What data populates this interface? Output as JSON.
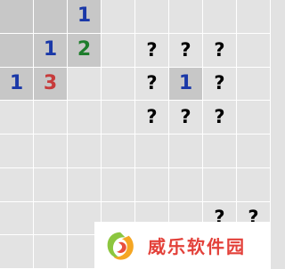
{
  "board": {
    "rows": 8,
    "cols": 8,
    "cells": [
      [
        "revealed",
        "revealed",
        "1",
        "covered",
        "covered",
        "covered",
        "covered",
        "covered"
      ],
      [
        "revealed",
        "1",
        "2",
        "covered",
        "?",
        "?",
        "?",
        "covered"
      ],
      [
        "1",
        "3",
        "covered",
        "covered",
        "?",
        "1",
        "?",
        "covered"
      ],
      [
        "covered",
        "covered",
        "covered",
        "covered",
        "?",
        "?",
        "?",
        "covered"
      ],
      [
        "covered",
        "covered",
        "covered",
        "covered",
        "covered",
        "covered",
        "covered",
        "covered"
      ],
      [
        "covered",
        "covered",
        "covered",
        "covered",
        "covered",
        "covered",
        "covered",
        "covered"
      ],
      [
        "covered",
        "covered",
        "covered",
        "covered",
        "covered",
        "covered",
        "?",
        "?"
      ],
      [
        "covered",
        "covered",
        "covered",
        "covered",
        "covered",
        "covered",
        "covered",
        "covered"
      ]
    ]
  },
  "colors": {
    "covered": "#e3e3e3",
    "revealed": "#c7c7c7",
    "number_1": "#1a38a8",
    "number_2": "#1e7d2c",
    "number_3": "#c73b3b"
  },
  "watermark": {
    "text": "威乐软件园",
    "logo_icon": "swirl-logo-icon"
  }
}
